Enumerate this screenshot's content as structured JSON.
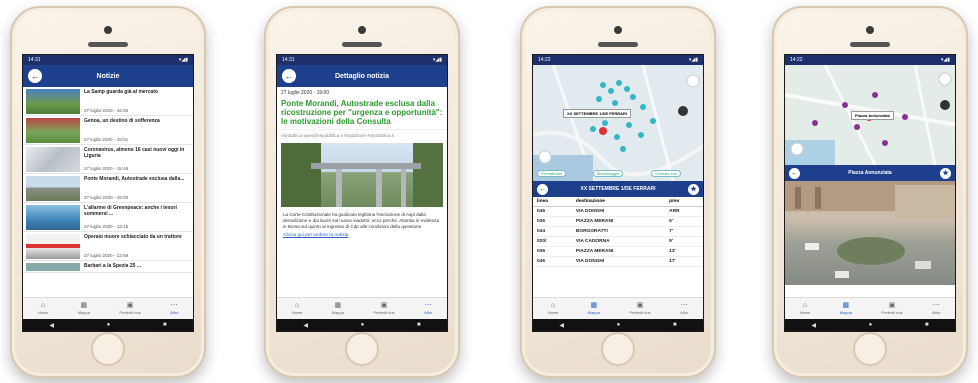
{
  "colors": {
    "appbar": "#1e3f8c",
    "accent_green": "#2e9a2e",
    "link": "#2a64c8"
  },
  "phone1": {
    "status_time": "14:31",
    "title": "Notizie",
    "news": [
      {
        "title": "La Samp guarda già al mercato",
        "date": "27 luglio 2020 - 15:56"
      },
      {
        "title": "Genoa, un destino di sofferenza",
        "date": "27 luglio 2020 - 15:51"
      },
      {
        "title": "Coronavirus, almeno 16 casi nuovi oggi in Liguria",
        "date": "27 luglio 2020 - 15:46"
      },
      {
        "title": "Ponte Morandi, Autostrade esclusa dalla...",
        "date": "27 luglio 2020 - 15:00"
      },
      {
        "title": "L'allarme di Greenpeace: anche i tesori sommersi ...",
        "date": "27 luglio 2020 - 13:15"
      },
      {
        "title": "Operaio muore schiacciato da un trattore",
        "date": "27 luglio 2020 - 12:59"
      },
      {
        "title": "Barbari a la Spezia 25 ...",
        "date": ""
      }
    ],
    "tabs": [
      "Home",
      "Mappa",
      "Preferiti bus",
      "Altro"
    ],
    "active_tab": 3
  },
  "phone2": {
    "status_time": "14:31",
    "title": "Dettaglio notizia",
    "date": "27 luglio 2020 - 15:00",
    "headline": "Ponte Morandi, Autostrade esclusa dalla ricostruzione per \"urgenza e opportunità\": le motivazioni della Consulta",
    "source": "repubblica www@repubblica.it Redazione Repubblica.it",
    "body": "La Corte Costituzionale ha giudicato legittima l'esclusione di Aspi dalla demolizione e dai lavori sul nuovo viadotto: ecco perché. Atlantia in evidenza in Borsa sul quinto al ingresso di Cdp alle condizioni della questione",
    "link": "Clicca qui per vedere la notizia",
    "tabs": [
      "Home",
      "Mappa",
      "Preferiti bus",
      "Altro"
    ],
    "active_tab": 3
  },
  "phone3": {
    "status_time": "14:22",
    "map_label": "XX SETTEMBRE 1/DE FERRARI",
    "chips": [
      "Fermate bus",
      "Monitoraggio",
      "Giornate bus"
    ],
    "stop_title": "XX SETTEMBRE 1/DE FERRARI",
    "columns": [
      "linea",
      "destinazione",
      "prev"
    ],
    "rows": [
      [
        "046",
        "VIA DONGHI",
        "ARR"
      ],
      [
        "036",
        "PIAZZA MERANI",
        "5'"
      ],
      [
        "044",
        "BORGORATTI",
        "7'"
      ],
      [
        "020/",
        "VIA CADORNA",
        "9'"
      ],
      [
        "036",
        "PIAZZA MERANI",
        "13'"
      ],
      [
        "046",
        "VIA DONGHI",
        "17'"
      ]
    ],
    "tabs": [
      "Home",
      "Mappa",
      "Preferiti bus",
      "Altro"
    ],
    "active_tab": 1
  },
  "phone4": {
    "status_time": "14:22",
    "map_label": "Piazza Annunziata",
    "place_title": "Piazza Annunziata",
    "tabs": [
      "Home",
      "Mappa",
      "Preferiti bus",
      "Altro"
    ],
    "active_tab": 1
  }
}
